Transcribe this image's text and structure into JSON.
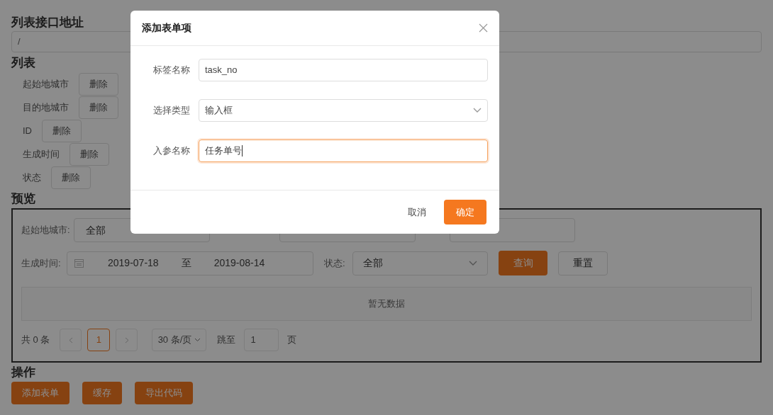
{
  "api_section": {
    "title": "列表接口地址",
    "url": "/"
  },
  "list_section": {
    "title": "列表",
    "items": [
      {
        "label": "起始地城市",
        "action": "删除"
      },
      {
        "label": "目的地城市",
        "action": "删除"
      },
      {
        "label": "ID",
        "action": "删除"
      },
      {
        "label": "生成时间",
        "action": "删除"
      },
      {
        "label": "状态",
        "action": "删除"
      }
    ]
  },
  "preview": {
    "title": "预览",
    "filters": [
      {
        "kind": "select",
        "label": "起始地城市:",
        "value": "全部"
      },
      {
        "kind": "select"
      },
      {
        "kind": "input"
      }
    ],
    "date_range": {
      "label": "生成时间:",
      "start": "2019-07-18",
      "separator": "至",
      "end": "2019-08-14"
    },
    "status": {
      "label": "状态:",
      "value": "全部"
    },
    "query_button": "查询",
    "reset_button": "重置",
    "empty_text": "暂无数据",
    "pagination": {
      "total": "共 0 条",
      "pages": [
        {
          "label": "1",
          "selected": true
        }
      ],
      "page_size": "30 条/页",
      "jump_label": "跳至",
      "jump_value": "1",
      "page_suffix": "页"
    }
  },
  "actions": {
    "title": "操作",
    "buttons": [
      "添加表单",
      "缓存",
      "导出代码"
    ]
  },
  "modal": {
    "title": "添加表单项",
    "fields": [
      {
        "kind": "input",
        "label": "标签名称",
        "value": "task_no",
        "focused": false
      },
      {
        "kind": "select",
        "label": "选择类型",
        "value": "输入框",
        "focused": false
      },
      {
        "kind": "input",
        "label": "入参名称",
        "value": "任务单号",
        "focused": true
      }
    ],
    "cancel": "取消",
    "ok": "确定"
  }
}
